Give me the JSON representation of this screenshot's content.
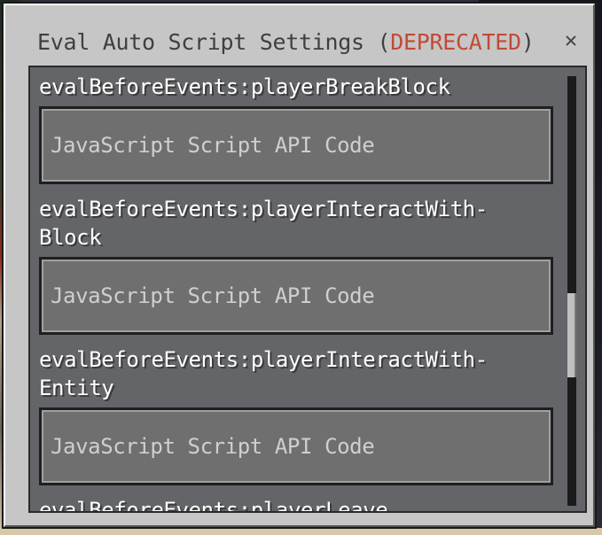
{
  "dialog": {
    "title_prefix": "Eval Auto Script Settings (",
    "title_status": "DEPRECATED",
    "title_suffix": ")",
    "close_glyph": "✕"
  },
  "events": [
    {
      "label": "evalBeforeEvents:playerBreakBlock",
      "placeholder": "JavaScript Script API Code",
      "value": ""
    },
    {
      "label": "evalBeforeEvents:playerInteractWith-\nBlock",
      "placeholder": "JavaScript Script API Code",
      "value": ""
    },
    {
      "label": "evalBeforeEvents:playerInteractWith-\nEntity",
      "placeholder": "JavaScript Script API Code",
      "value": ""
    },
    {
      "label": "evalBeforeEvents:playerLeave",
      "placeholder": "",
      "value": ""
    }
  ],
  "colors": {
    "panel": "#c6c6c6",
    "deprecated": "#c24a35",
    "field": "#6f6f6f"
  }
}
